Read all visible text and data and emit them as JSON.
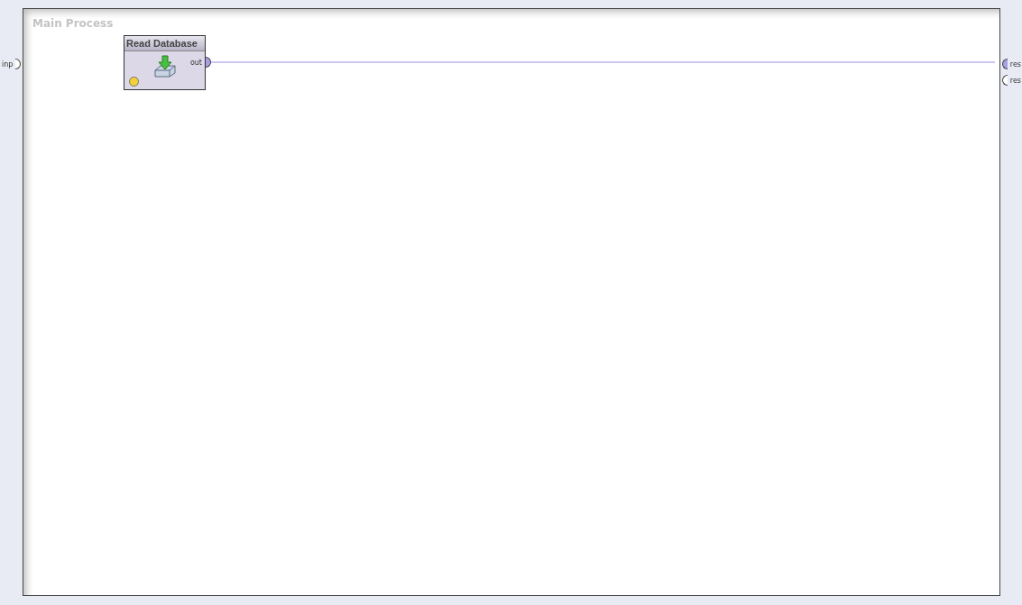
{
  "process": {
    "title": "Main Process",
    "input_ports": [
      {
        "label": "inp",
        "connected": false
      }
    ],
    "result_ports": [
      {
        "label": "res",
        "connected": true
      },
      {
        "label": "res",
        "connected": false
      }
    ]
  },
  "operators": [
    {
      "title": "Read Database",
      "color": "#f2d13a",
      "output_ports": [
        {
          "label": "out",
          "connected": true
        }
      ]
    }
  ]
}
